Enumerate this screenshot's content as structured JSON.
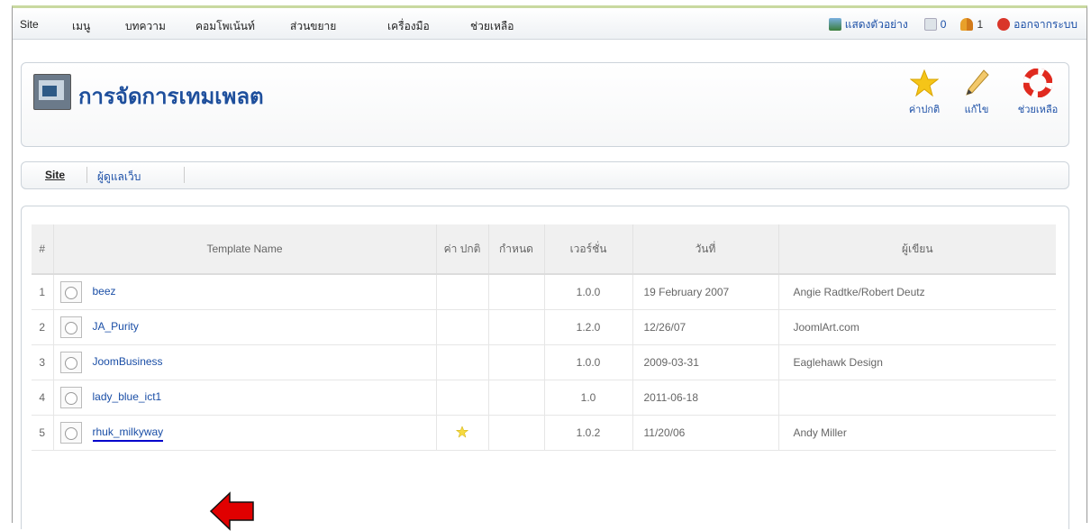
{
  "menu": {
    "items": [
      "Site",
      "เมนู",
      "บทความ",
      "คอมโพเน้นท์",
      "ส่วนขยาย",
      "เครื่องมือ",
      "ช่วยเหลือ"
    ],
    "preview": "แสดงตัวอย่าง",
    "messages_count": "0",
    "users_count": "1",
    "logout": "ออกจากระบบ"
  },
  "header": {
    "title": "การจัดการเทมเพลต",
    "default_label": "ค่าปกติ",
    "edit_label": "แก้ไข",
    "help_label": "ช่วยเหลือ"
  },
  "submenu": {
    "items": [
      "Site",
      "ผู้ดูแลเว็บ"
    ]
  },
  "table": {
    "headers": {
      "num": "#",
      "name": "Template Name",
      "default": "ค่า ปกติ",
      "assigned": "กำหนด",
      "version": "เวอร์ชั่น",
      "date": "วันที่",
      "author": "ผู้เขียน"
    },
    "rows": [
      {
        "num": "1",
        "name": "beez",
        "version": "1.0.0",
        "date": "19 February 2007",
        "author": "Angie Radtke/Robert Deutz"
      },
      {
        "num": "2",
        "name": "JA_Purity",
        "version": "1.2.0",
        "date": "12/26/07",
        "author": "JoomlArt.com"
      },
      {
        "num": "3",
        "name": "JoomBusiness",
        "version": "1.0.0",
        "date": "2009-03-31",
        "author": "Eaglehawk Design"
      },
      {
        "num": "4",
        "name": "lady_blue_ict1",
        "version": "1.0",
        "date": "2011-06-18",
        "author": ""
      },
      {
        "num": "5",
        "name": "rhuk_milkyway",
        "version": "1.0.2",
        "date": "11/20/06",
        "author": "Andy Miller"
      }
    ]
  },
  "colors": {
    "link": "#1a4ea6",
    "arrow": "#e00000",
    "underline": "#0000cc"
  }
}
